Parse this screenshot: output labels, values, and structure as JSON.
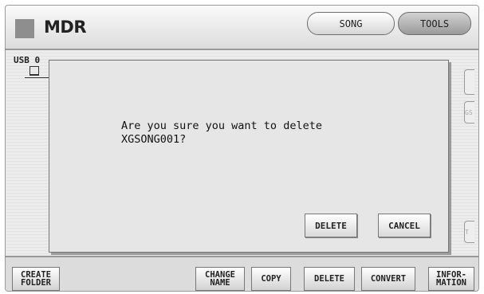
{
  "header": {
    "title": "MDR",
    "song_tab": "SONG",
    "tools_tab": "TOOLS"
  },
  "main": {
    "device_label": "USB 0",
    "edge_label_2": "GS",
    "edge_label_3": "T"
  },
  "dialog": {
    "message": "Are you sure you want to delete\nXGSONG001?",
    "delete_label": "DELETE",
    "cancel_label": "CANCEL"
  },
  "bottom_bar": {
    "create_folder": "CREATE\nFOLDER",
    "change_name": "CHANGE\nNAME",
    "copy": "COPY",
    "delete": "DELETE",
    "convert": "CONVERT",
    "information": "INFOR-\nMATION"
  }
}
